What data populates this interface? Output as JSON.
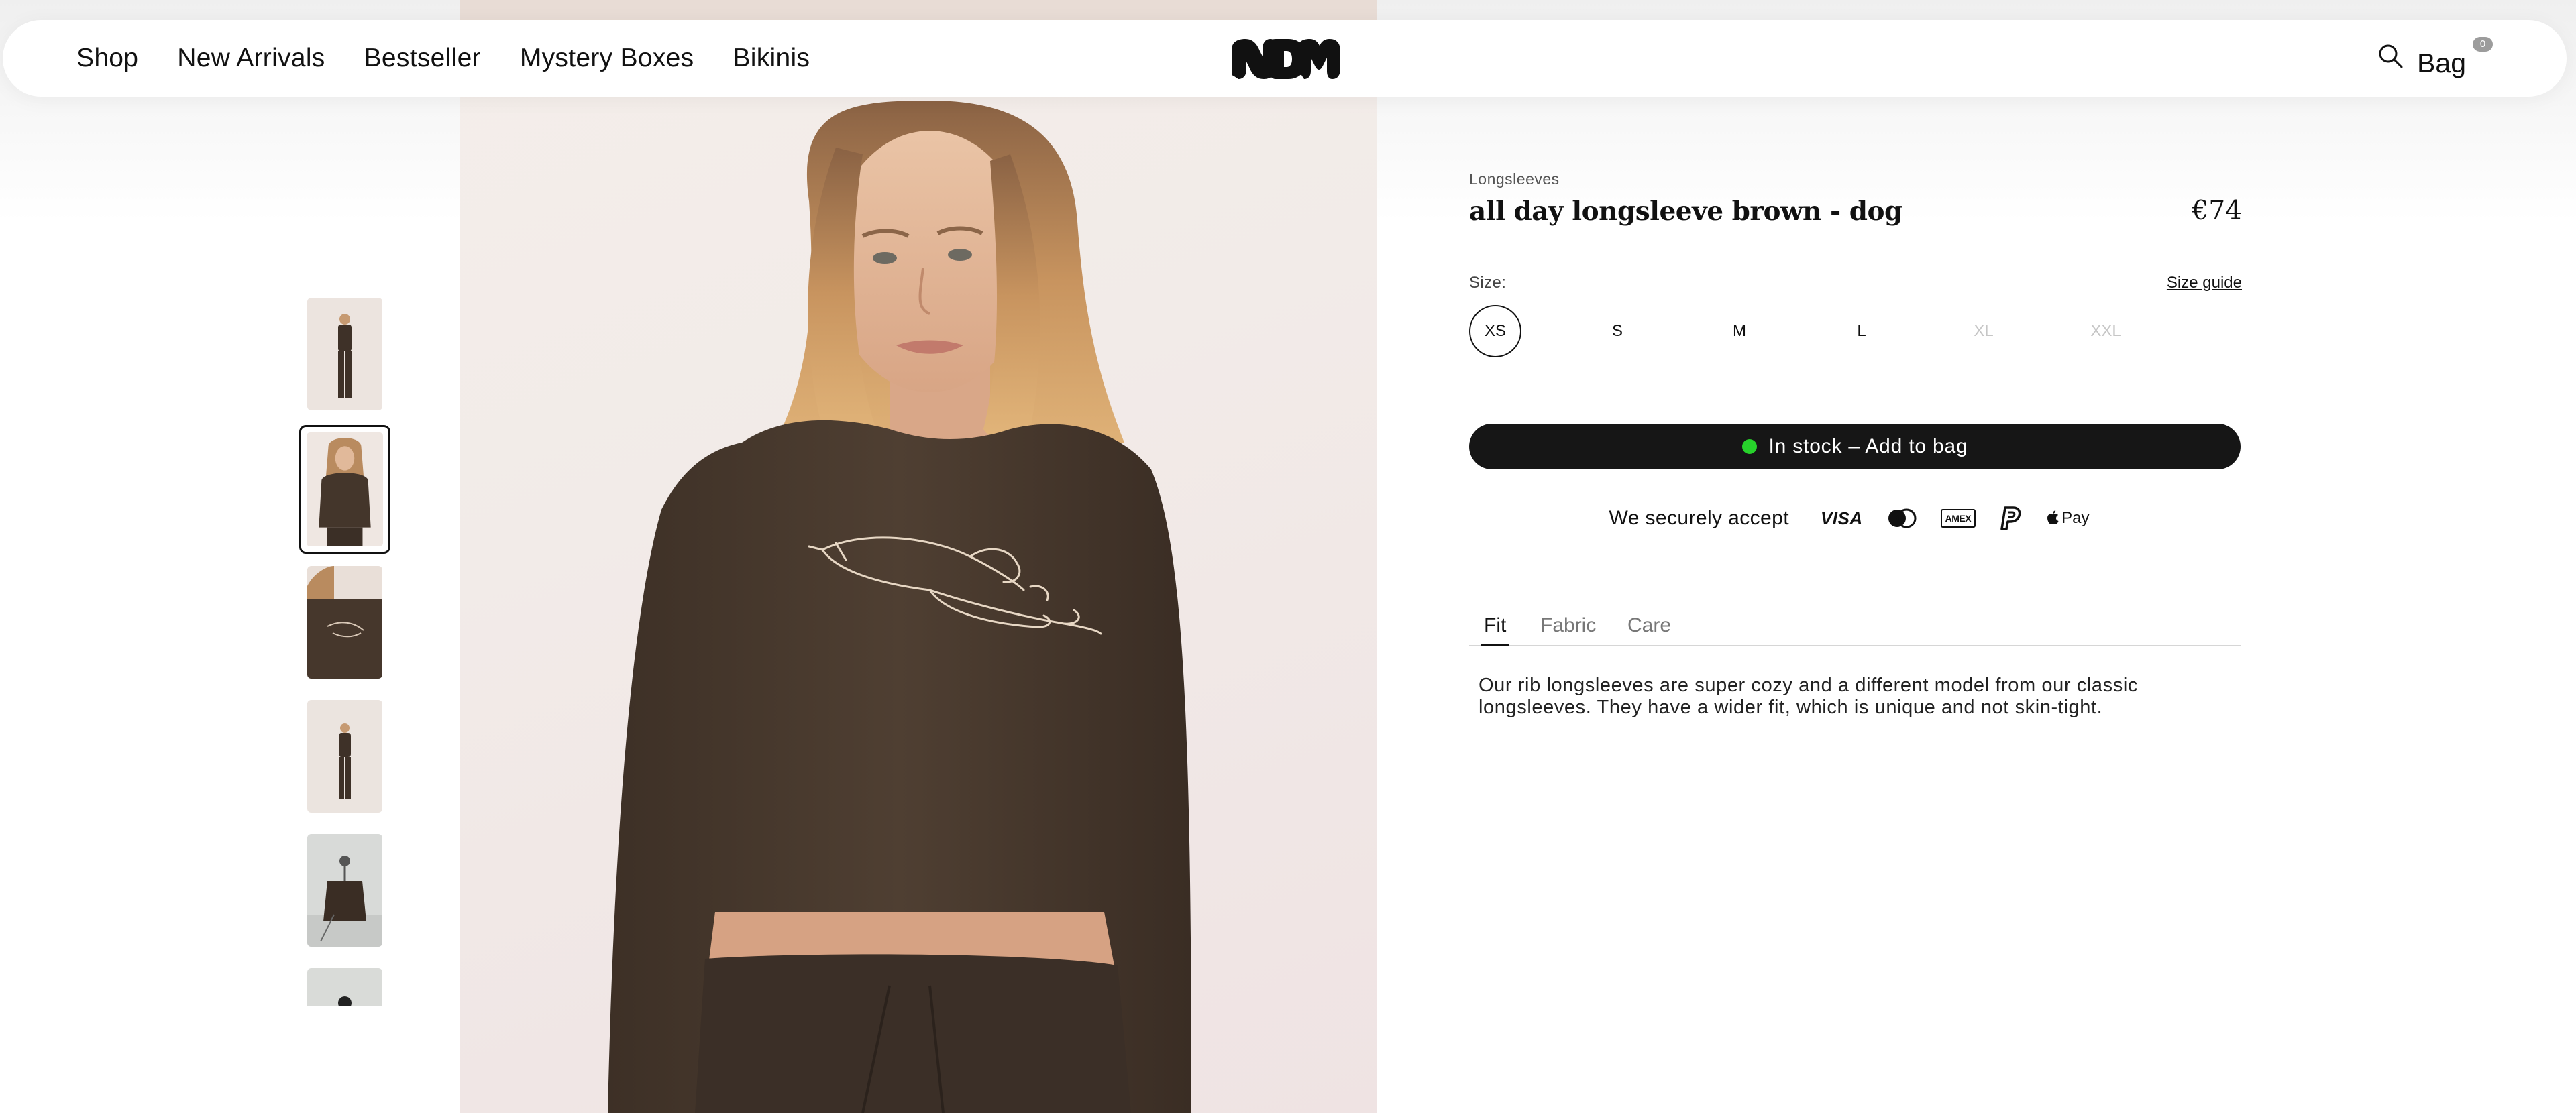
{
  "nav": {
    "items": [
      "Shop",
      "New Arrivals",
      "Bestseller",
      "Mystery Boxes",
      "Bikinis"
    ],
    "logo_text": "NDM",
    "bag_label": "Bag",
    "bag_count": "0",
    "search_icon": "search-icon"
  },
  "gallery": {
    "thumbnail_count": 6,
    "active_thumbnail": 2
  },
  "product": {
    "category": "Longsleeves",
    "title": "all day longsleeve brown - dog",
    "price": "€74",
    "size_label": "Size:",
    "size_guide": "Size guide",
    "sizes": [
      {
        "label": "XS",
        "state": "selected"
      },
      {
        "label": "S",
        "state": "available"
      },
      {
        "label": "M",
        "state": "available"
      },
      {
        "label": "L",
        "state": "available"
      },
      {
        "label": "XL",
        "state": "unavailable"
      },
      {
        "label": "XXL",
        "state": "unavailable"
      }
    ],
    "add_to_bag": "In stock – Add to bag",
    "stock_color": "#27d22b",
    "payments_label": "We securely accept",
    "payment_methods": [
      "visa-icon",
      "mastercard-icon",
      "amex-icon",
      "paypal-icon",
      "apple-pay-icon"
    ],
    "visa_text": "VISA",
    "amex_text": "AMEX",
    "applepay_text": "Pay",
    "tabs": [
      "Fit",
      "Fabric",
      "Care"
    ],
    "active_tab": "Fit",
    "description": "Our rib longsleeves are super cozy and a different model from our classic longsleeves. They have a wider fit, which is unique and not skin-tight."
  },
  "colors": {
    "button_bg": "#161616",
    "shirt": "#4a3a2e",
    "background": "#ffffff"
  }
}
